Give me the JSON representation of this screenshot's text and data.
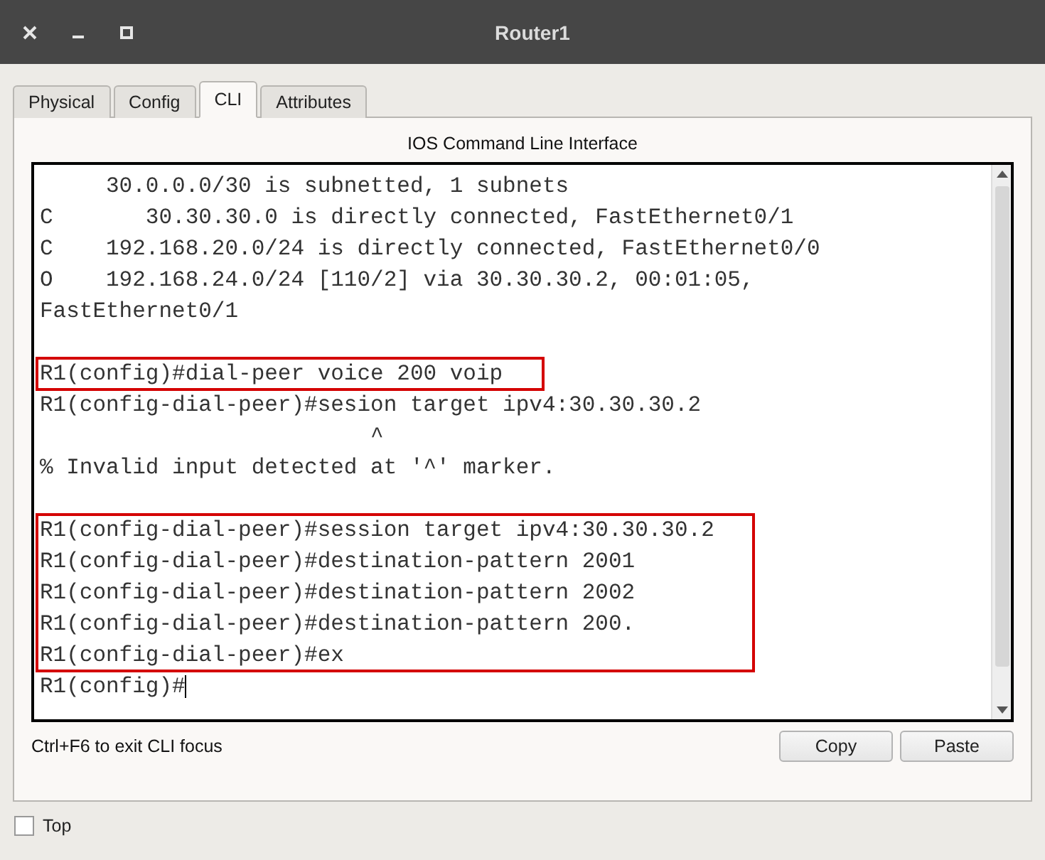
{
  "window": {
    "title": "Router1"
  },
  "tabs": [
    {
      "label": "Physical",
      "selected": false
    },
    {
      "label": "Config",
      "selected": false
    },
    {
      "label": "CLI",
      "selected": true
    },
    {
      "label": "Attributes",
      "selected": false
    }
  ],
  "cli": {
    "heading": "IOS Command Line Interface",
    "blocks": [
      {
        "gap_before": false,
        "highlighted": false,
        "lines": [
          "     30.0.0.0/30 is subnetted, 1 subnets",
          "C       30.30.30.0 is directly connected, FastEthernet0/1",
          "C    192.168.20.0/24 is directly connected, FastEthernet0/0",
          "O    192.168.24.0/24 [110/2] via 30.30.30.2, 00:01:05,",
          "FastEthernet0/1"
        ]
      },
      {
        "gap_before": true,
        "highlighted": true,
        "lines": [
          "R1(config)#dial-peer voice 200 voip"
        ]
      },
      {
        "gap_before": false,
        "highlighted": false,
        "lines": [
          "R1(config-dial-peer)#sesion target ipv4:30.30.30.2",
          "                         ^",
          "% Invalid input detected at '^' marker."
        ]
      },
      {
        "gap_before": true,
        "highlighted": true,
        "lines": [
          "R1(config-dial-peer)#session target ipv4:30.30.30.2",
          "R1(config-dial-peer)#destination-pattern 2001",
          "R1(config-dial-peer)#destination-pattern 2002",
          "R1(config-dial-peer)#destination-pattern 200.",
          "R1(config-dial-peer)#ex"
        ]
      },
      {
        "gap_before": false,
        "highlighted": false,
        "lines": [
          "R1(config)#"
        ]
      }
    ],
    "hint": "Ctrl+F6 to exit CLI focus",
    "buttons": [
      "Copy",
      "Paste"
    ]
  },
  "top_checkbox": {
    "label": "Top",
    "checked": false
  }
}
